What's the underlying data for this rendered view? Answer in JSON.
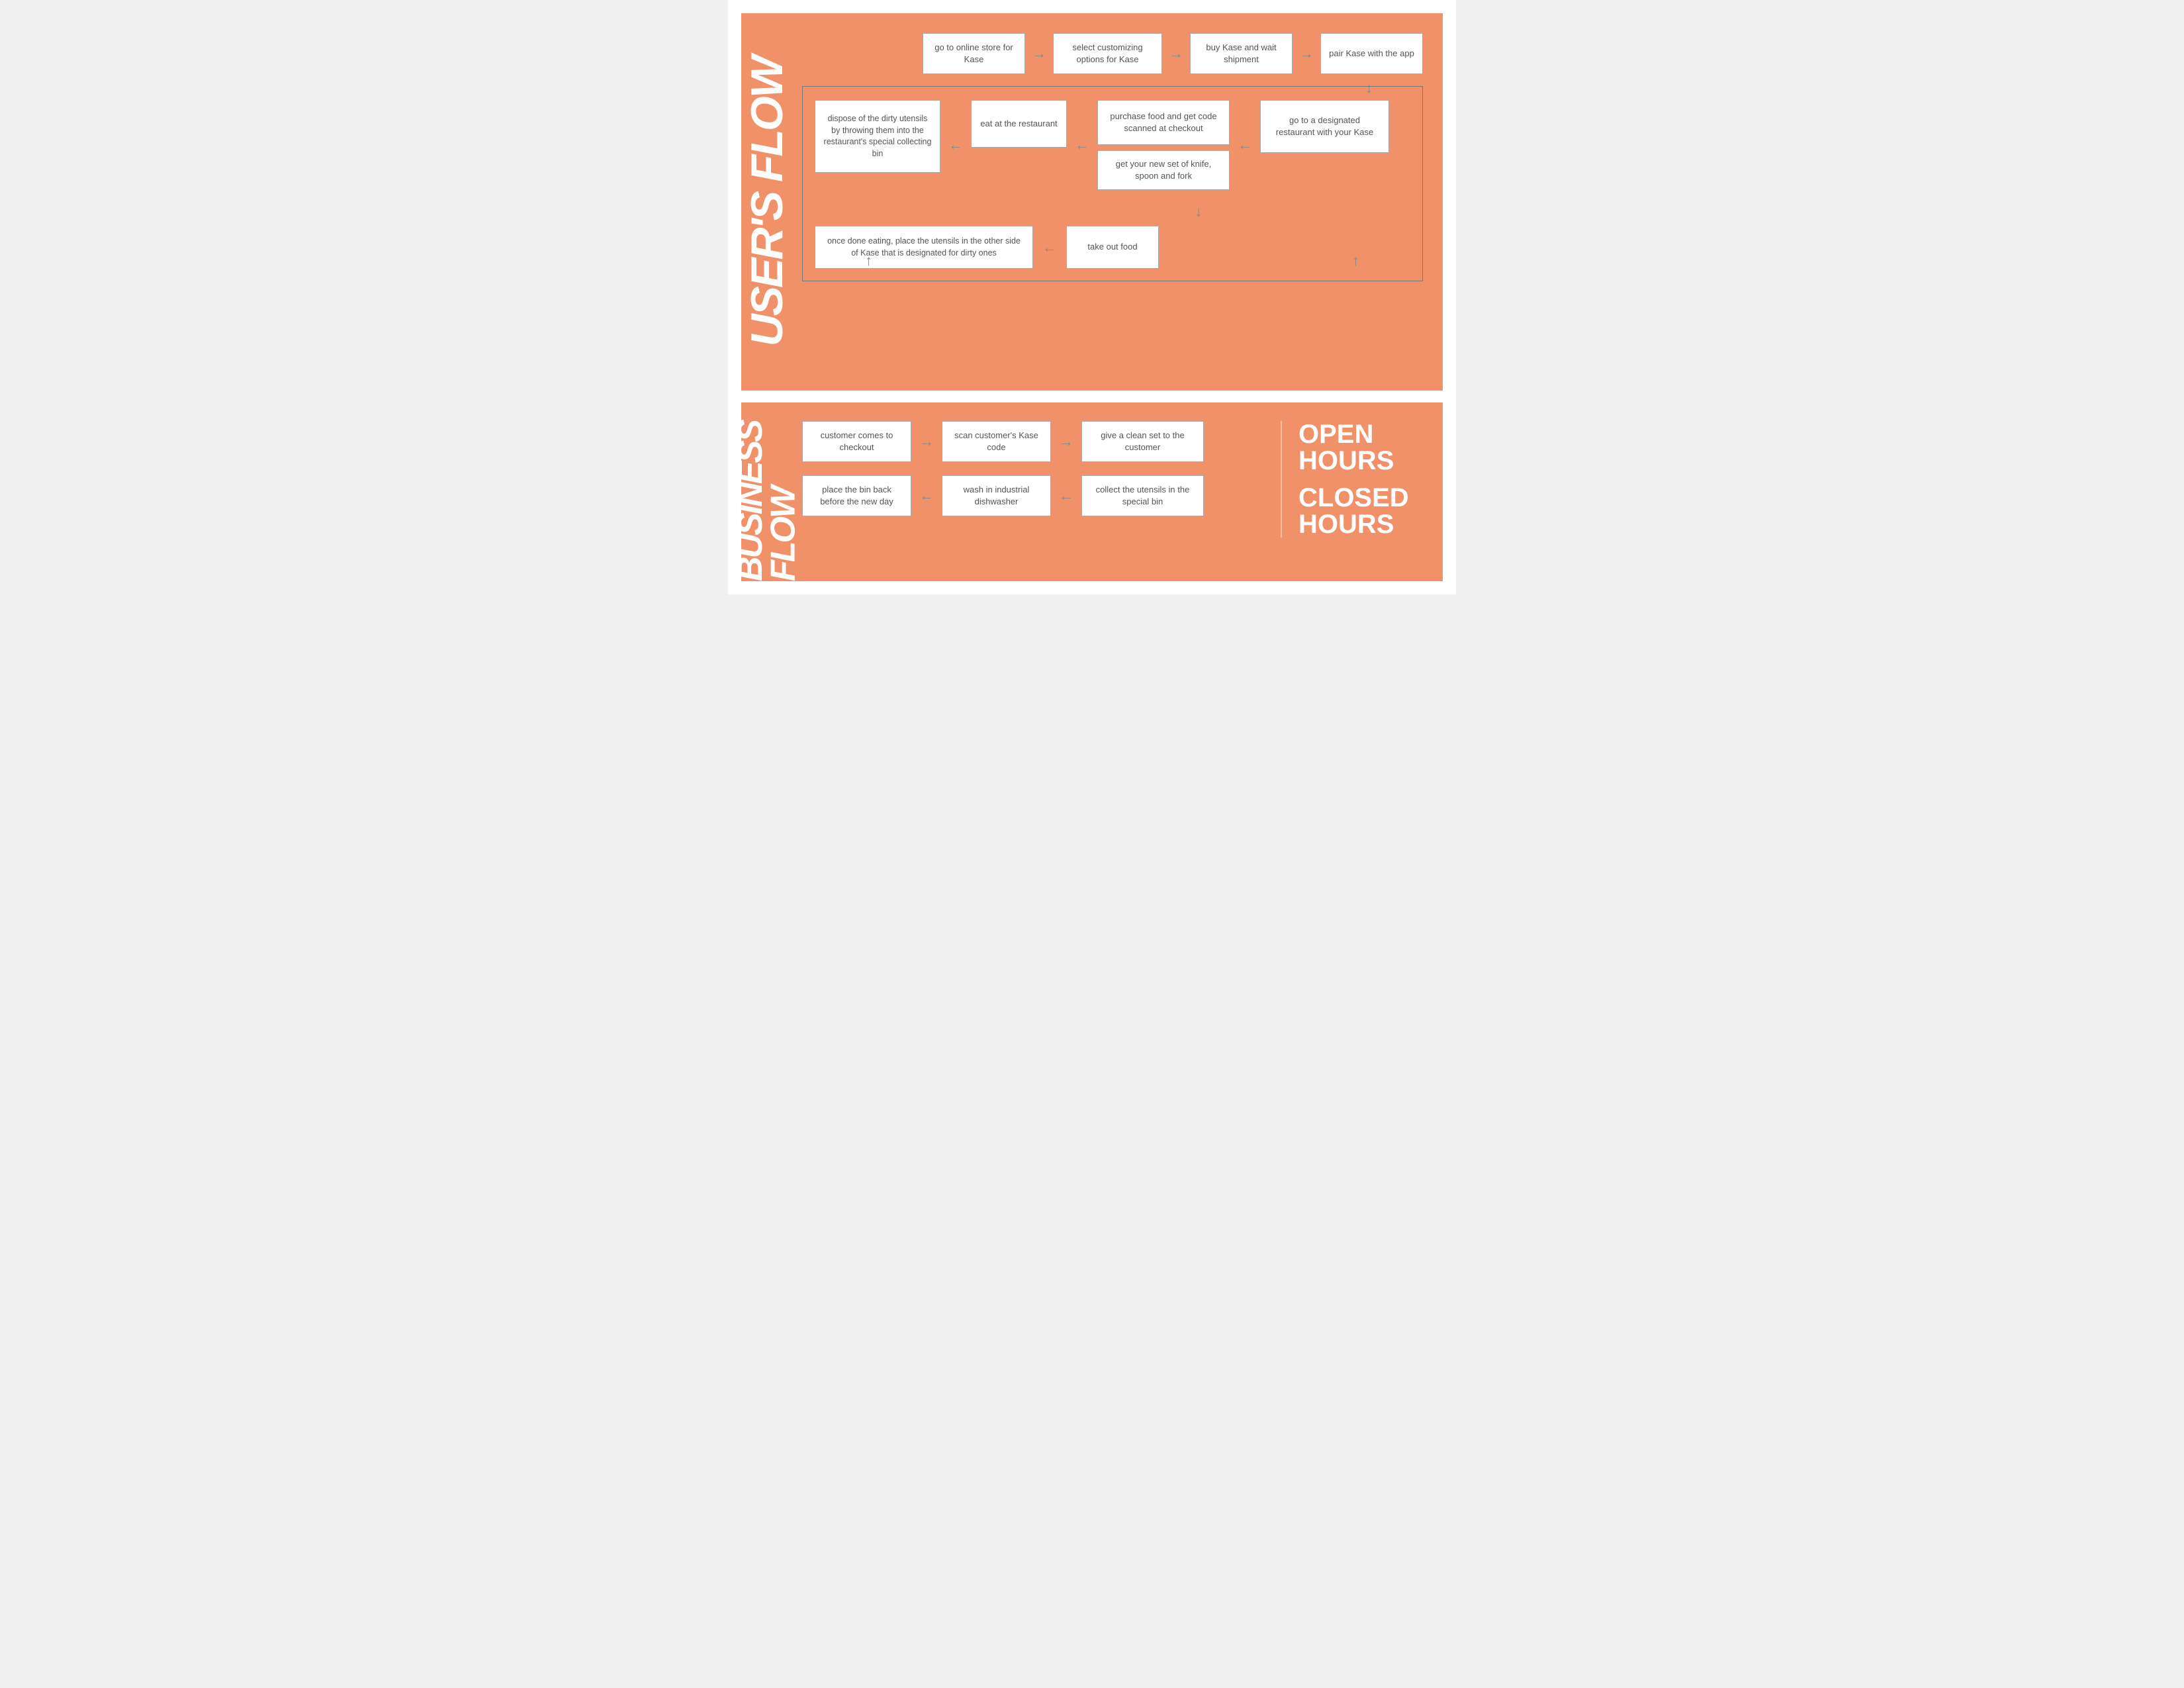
{
  "colors": {
    "bg_orange": "#f0916a",
    "white": "#ffffff",
    "box_border": "#aaaaaa",
    "text": "#555555",
    "arrow": "#888888"
  },
  "users_flow": {
    "section_label_line1": "USER'S",
    "section_label_line2": "FLOW",
    "top_row": [
      {
        "id": "go-online",
        "text": "go to online store for Kase"
      },
      {
        "id": "select-options",
        "text": "select customizing options for Kase"
      },
      {
        "id": "buy-kase",
        "text": "buy Kase and wait shipment"
      },
      {
        "id": "pair-kase",
        "text": "pair Kase with the app"
      }
    ],
    "mid_left": {
      "id": "dispose-utensils",
      "text": "dispose of the dirty utensils by throwing them into the restaurant's special collecting bin"
    },
    "mid_eat": {
      "id": "eat-restaurant",
      "text": "eat at the restaurant"
    },
    "mid_purchase": {
      "id": "purchase-food",
      "text": "purchase food and get code scanned at checkout"
    },
    "mid_get_set": {
      "id": "get-set",
      "text": "get your new set of knife, spoon and fork"
    },
    "mid_go_restaurant": {
      "id": "go-restaurant",
      "text": "go to a designated restaurant with your Kase"
    },
    "bottom_once_done": {
      "id": "once-done",
      "text": "once done eating, place the utensils in the other side of Kase that is designated for dirty ones"
    },
    "bottom_take_out": {
      "id": "take-out",
      "text": "take out food"
    }
  },
  "business_flow": {
    "section_label_line1": "BUSINESS",
    "section_label_line2": "FLOW",
    "row1": [
      {
        "id": "customer-checkout",
        "text": "customer comes to checkout"
      },
      {
        "id": "scan-kase",
        "text": "scan customer's Kase code"
      },
      {
        "id": "give-clean-set",
        "text": "give a clean set to the customer"
      }
    ],
    "row2": [
      {
        "id": "place-bin-back",
        "text": "place the bin back before the new day"
      },
      {
        "id": "wash-industrial",
        "text": "wash in industrial dishwasher"
      },
      {
        "id": "collect-utensils",
        "text": "collect the utensils in the special bin"
      }
    ],
    "open_hours": "OPEN HOURS",
    "closed_hours": "CLOSED HOURS"
  }
}
